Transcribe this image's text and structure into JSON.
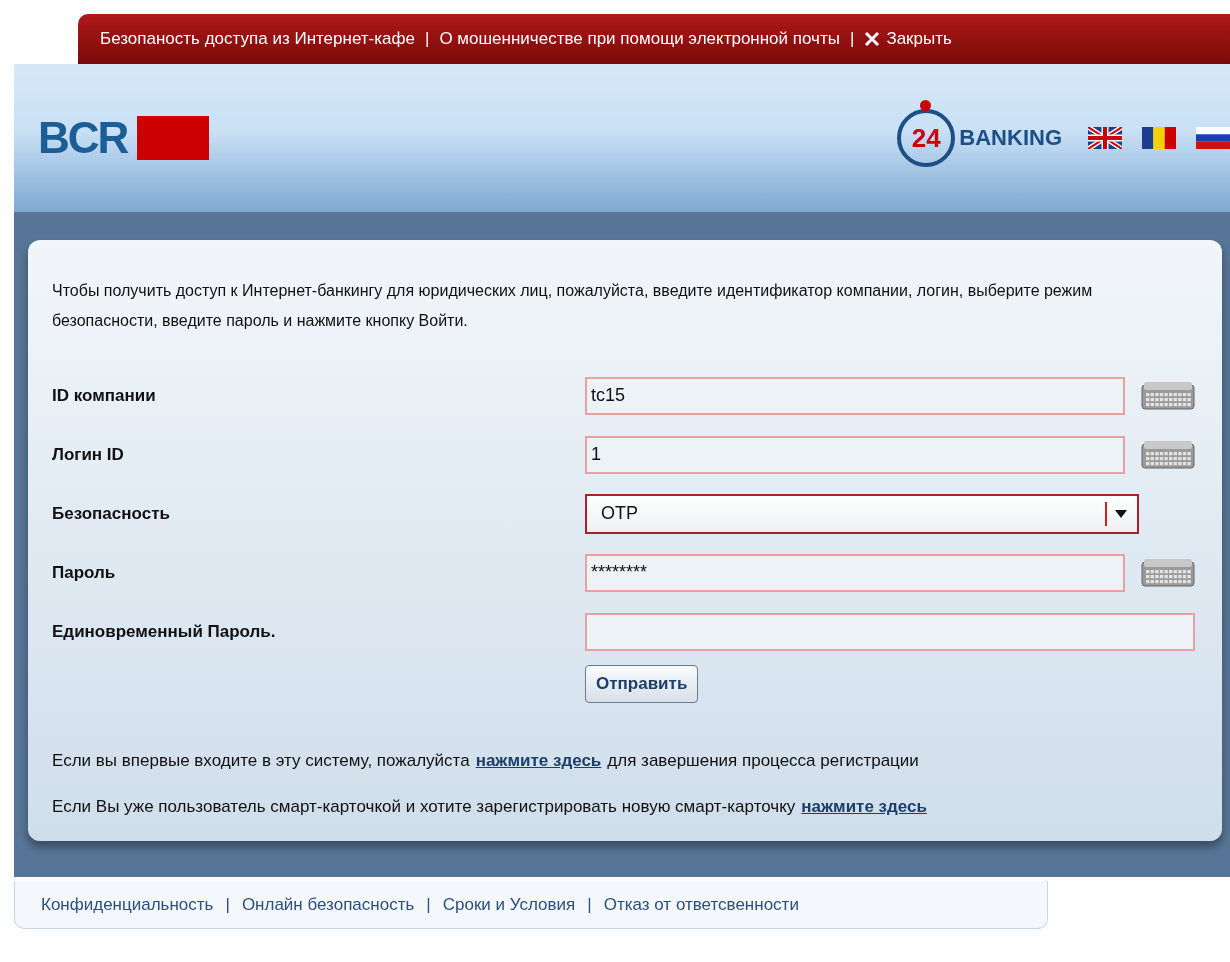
{
  "top_bar": {
    "links": [
      "Безопаность доступа из Интернет-кафе",
      "О мошенничестве при помощи электронной почты"
    ],
    "close_label": "Закрыть",
    "separator": "|"
  },
  "header": {
    "logo": "BCR",
    "badge_number": "24",
    "badge_word": "BANKING"
  },
  "intro": "Чтобы получить доступ к Интернет-банкингу для юридических лиц, пожалуйста, введите идентификатор компании, логин, выберите режим безопасности, введите пароль и нажмите кнопку Войти.",
  "fields": [
    {
      "kind": "text",
      "label": "ID компании",
      "value": "tc15",
      "keyboard": true
    },
    {
      "kind": "text",
      "label": "Логин ID",
      "value": "1",
      "keyboard": true
    },
    {
      "kind": "select",
      "label": "Безопасность",
      "value": "OTP",
      "keyboard": false
    },
    {
      "kind": "password",
      "label": "Пароль",
      "value": "********",
      "keyboard": true
    },
    {
      "kind": "text",
      "label": "Единовременный Пароль.",
      "keyboard": false
    }
  ],
  "submit": "Отправить",
  "notes": [
    {
      "before": "Если вы впервые входите в эту систему, пожалуйста",
      "link": "нажмите здесь",
      "after": "для завершения процесса регистрации"
    },
    {
      "before": "Если Вы уже пользователь смарт-карточкой и хотите зарегистрировать новую смарт-карточку",
      "link": "нажмите здесь"
    }
  ],
  "footer": {
    "links": [
      "Конфиденциальность",
      "Онлайн безопасность",
      "Сроки и Условия",
      "Отказ от ответсвенности"
    ],
    "separator": "|"
  }
}
